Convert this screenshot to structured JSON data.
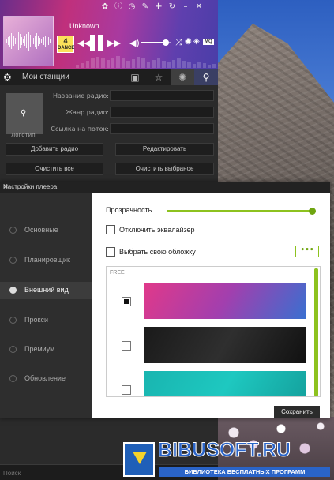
{
  "player": {
    "track_title": "Unknown",
    "station_logo_number": "4",
    "station_logo_text": "DANCE",
    "quality_badge": "MQ",
    "volume_level": 0.85,
    "top_icons": [
      "gear-icon",
      "info-icon",
      "timer-icon",
      "pen-icon",
      "wrench-icon",
      "refresh-icon",
      "minimize-icon",
      "close-icon"
    ],
    "controls": [
      "prev-icon",
      "play-pause-icon",
      "next-icon",
      "volume-icon",
      "shuffle-icon",
      "vk-icon",
      "share-icon"
    ]
  },
  "nav": {
    "title": "Мои станции",
    "icons": [
      "radio-icon",
      "star-icon",
      "waveform-icon",
      "search-icon"
    ]
  },
  "station_form": {
    "logo_label": "Логотип",
    "name_label": "Название радио:",
    "genre_label": "Жанр радио:",
    "stream_label": "Ссылка на поток:",
    "name_value": "",
    "genre_value": "",
    "stream_value": "",
    "add_button": "Добавить радио",
    "edit_button": "Редактировать",
    "clear_all_button": "Очистить все",
    "clear_selected_button": "Очистить выбраное"
  },
  "search": {
    "placeholder": "Поиск"
  },
  "settings": {
    "title": "Настройки плеера",
    "menu": [
      {
        "label": "Основные",
        "active": false
      },
      {
        "label": "Планировщик",
        "active": false
      },
      {
        "label": "Внешний вид",
        "active": true
      },
      {
        "label": "Прокси",
        "active": false
      },
      {
        "label": "Премиум",
        "active": false
      },
      {
        "label": "Обновление",
        "active": false
      }
    ],
    "transparency_label": "Прозрачность",
    "transparency_value": 1.0,
    "disable_eq_label": "Отключить эквалайзер",
    "disable_eq_checked": false,
    "custom_cover_label": "Выбрать свою обложку",
    "custom_cover_checked": false,
    "more_button": "•••",
    "skin_category": "FREE",
    "skins": [
      {
        "selected": true,
        "colors": [
          "#e0398a",
          "#a23fae",
          "#3a6fd0"
        ]
      },
      {
        "selected": false,
        "colors": [
          "#1a1a1a",
          "#2f2f2f",
          "#111111"
        ]
      },
      {
        "selected": false,
        "colors": [
          "#19b5b0",
          "#1ec8c0",
          "#14a09c"
        ]
      }
    ],
    "save_button": "Сохранить",
    "accent_color": "#8dc21f"
  },
  "watermark": {
    "title": "BIBUSOFT.RU",
    "subtitle": "БИБЛИОТЕКА БЕСПЛАТНЫХ ПРОГРАММ"
  }
}
